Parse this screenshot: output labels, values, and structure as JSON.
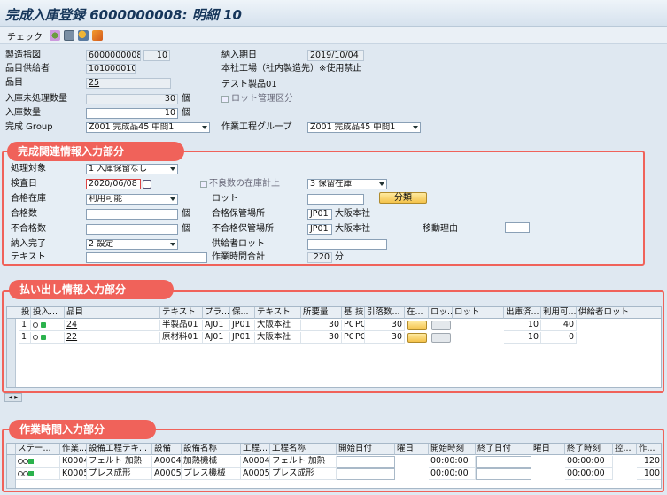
{
  "title": "完成入庫登録 6000000008: 明細 10",
  "toolbar": {
    "check_label": "チェック"
  },
  "header": {
    "order_label": "製造指図",
    "order_value": "6000000008",
    "order_item": "10",
    "delivery_date_label": "納入期日",
    "delivery_date_value": "2019/10/04",
    "supplier_label": "品目供給者",
    "supplier_value": "101000010",
    "plant_text": "本社工場（社内製造先）※使用禁止",
    "material_label": "品目",
    "material_value": "25",
    "material_text": "テスト製品01",
    "unprocessed_label": "入庫未処理数量",
    "unprocessed_value": "30",
    "unprocessed_unit": "個",
    "lot_mgmt_label": "ロット管理区分",
    "receipt_qty_label": "入庫数量",
    "receipt_qty_value": "10",
    "receipt_qty_unit": "個",
    "completion_group_label": "完成 Group",
    "completion_group_value": "Z001 完成品45 中間1",
    "work_group_label": "作業工程グループ",
    "work_group_value": "Z001 完成品45 中間1"
  },
  "section1": {
    "title": "完成関連情報入力部分",
    "process_label": "処理対象",
    "process_value": "1 入庫保留なし",
    "inspect_date_label": "検査日",
    "inspect_date_value": "2020/06/08",
    "defect_label": "不良数の在庫計上",
    "stock_type_value": "3 保留在庫",
    "pass_stock_label": "合格在庫",
    "pass_stock_value": "利用可能",
    "lot_label": "ロット",
    "classify_label": "分類",
    "pass_qty_label": "合格数",
    "pass_qty_unit": "個",
    "pass_loc_label": "合格保管場所",
    "pass_loc_value": "JP01",
    "pass_loc_text": "大阪本社",
    "fail_qty_label": "不合格数",
    "fail_qty_unit": "個",
    "fail_loc_label": "不合格保管場所",
    "fail_loc_value": "JP01",
    "fail_loc_text": "大阪本社",
    "move_reason_label": "移動理由",
    "delivery_done_label": "納入完了",
    "delivery_done_value": "2 設定",
    "supplier_lot_label": "供給者ロット",
    "text_label": "テキスト",
    "work_time_label": "作業時間合計",
    "work_time_value": "220",
    "work_time_unit": "分"
  },
  "section2": {
    "title": "払い出し情報入力部分",
    "headers": [
      "",
      "投入...",
      "品目",
      "テキスト",
      "プラ...",
      "保...",
      "テキスト",
      "所要量",
      "基",
      "技",
      "引落数...",
      "在...",
      "ロッ...",
      "ロット",
      "出庫済...",
      "利用可...",
      "供給者ロット"
    ],
    "rows": [
      [
        "1",
        "",
        "24",
        "半製品01",
        "AJ01",
        "JP01",
        "大阪本社",
        "30",
        "PC",
        "PC",
        "30",
        "",
        "",
        "",
        "10",
        "40",
        ""
      ],
      [
        "1",
        "",
        "22",
        "原材料01",
        "AJ01",
        "JP01",
        "大阪本社",
        "30",
        "PC",
        "PC",
        "30",
        "",
        "",
        "",
        "10",
        "0",
        ""
      ]
    ]
  },
  "section3": {
    "title": "作業時間入力部分",
    "headers": [
      "ステー...",
      "作業...",
      "設備工程テキ...",
      "設備",
      "設備名称",
      "工程...",
      "工程名称",
      "開始日付",
      "曜日",
      "開始時刻",
      "終了日付",
      "曜日",
      "終了時刻",
      "控...",
      "作..."
    ],
    "rows": [
      [
        "",
        "K0004",
        "フェルト 加熱",
        "A0004",
        "加熱機械",
        "A0004",
        "フェルト 加熱",
        "",
        "",
        "00:00:00",
        "",
        "",
        "00:00:00",
        "",
        "120"
      ],
      [
        "",
        "K0005",
        "プレス成形",
        "A0005",
        "プレス機械",
        "A0005",
        "プレス成形",
        "",
        "",
        "00:00:00",
        "",
        "",
        "00:00:00",
        "",
        "100"
      ]
    ]
  },
  "colors": {
    "accent_red": "#f0625a",
    "title_blue": "#16365a"
  }
}
